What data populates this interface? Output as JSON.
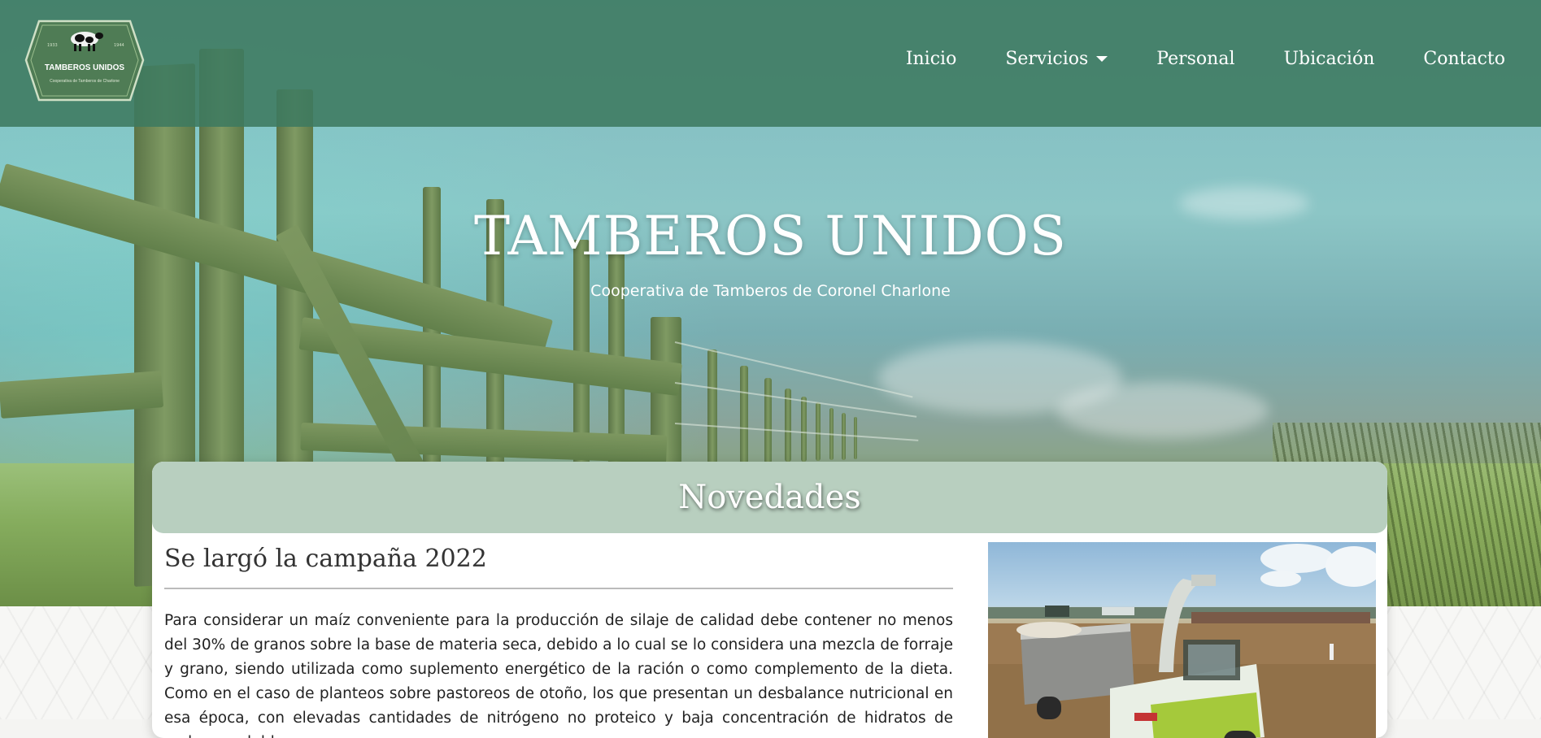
{
  "navbar": {
    "logo": {
      "name": "TAMBEROS UNIDOS",
      "tagline": "Cooperativa de Tamberos de Charlone",
      "year_left": "1933",
      "year_right": "1944"
    },
    "links": [
      {
        "label": "Inicio"
      },
      {
        "label": "Servicios",
        "dropdown": true
      },
      {
        "label": "Personal"
      },
      {
        "label": "Ubicación"
      },
      {
        "label": "Contacto"
      }
    ]
  },
  "hero": {
    "title": "TAMBEROS UNIDOS",
    "subtitle": "Cooperativa de Tamberos de Coronel Charlone"
  },
  "news": {
    "heading": "Novedades",
    "article": {
      "title": "Se largó la campaña 2022",
      "body": "Para considerar un maíz conveniente para la producción de silaje de calidad debe contener no menos del 30% de granos sobre la base de materia seca, debido a lo cual se lo considera una mezcla de forraje y grano, siendo utilizada como suplemento energético de la ración o como complemento de la dieta. Como en el caso de planteos sobre pastoreos de otoño, los que presentan un desbalance nutricional en esa época, con elevadas cantidades de nitrógeno no proteico y baja concentración de hidratos de carbono solubles."
    }
  },
  "colors": {
    "navbar": "#3e7a60",
    "card_header": "#b8cfbf"
  }
}
